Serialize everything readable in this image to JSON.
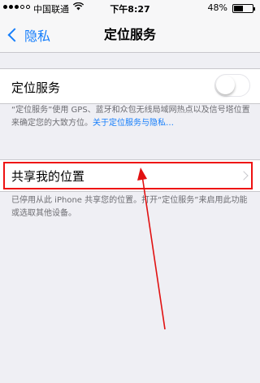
{
  "status_bar": {
    "carrier": "中国联通",
    "wifi_icon": "wifi-icon",
    "time": "下午8:27",
    "battery_percent": "48%",
    "battery_level": 0.48
  },
  "nav": {
    "back_label": "隐私",
    "title": "定位服务"
  },
  "location_services": {
    "label": "定位服务",
    "enabled": false
  },
  "location_footnote": {
    "text": "“定位服务”使用 GPS、蓝牙和众包无线局域网热点以及信号塔位置来确定您的大致方位。",
    "link": "关于定位服务与隐私…"
  },
  "share_location": {
    "label": "共享我的位置"
  },
  "share_footnote": "已停用从此 iPhone 共享您的位置。打开“定位服务”来启用此功能或选取其他设备。",
  "colors": {
    "accent": "#157efb",
    "annotation": "#e11111",
    "background": "#efeff4"
  }
}
